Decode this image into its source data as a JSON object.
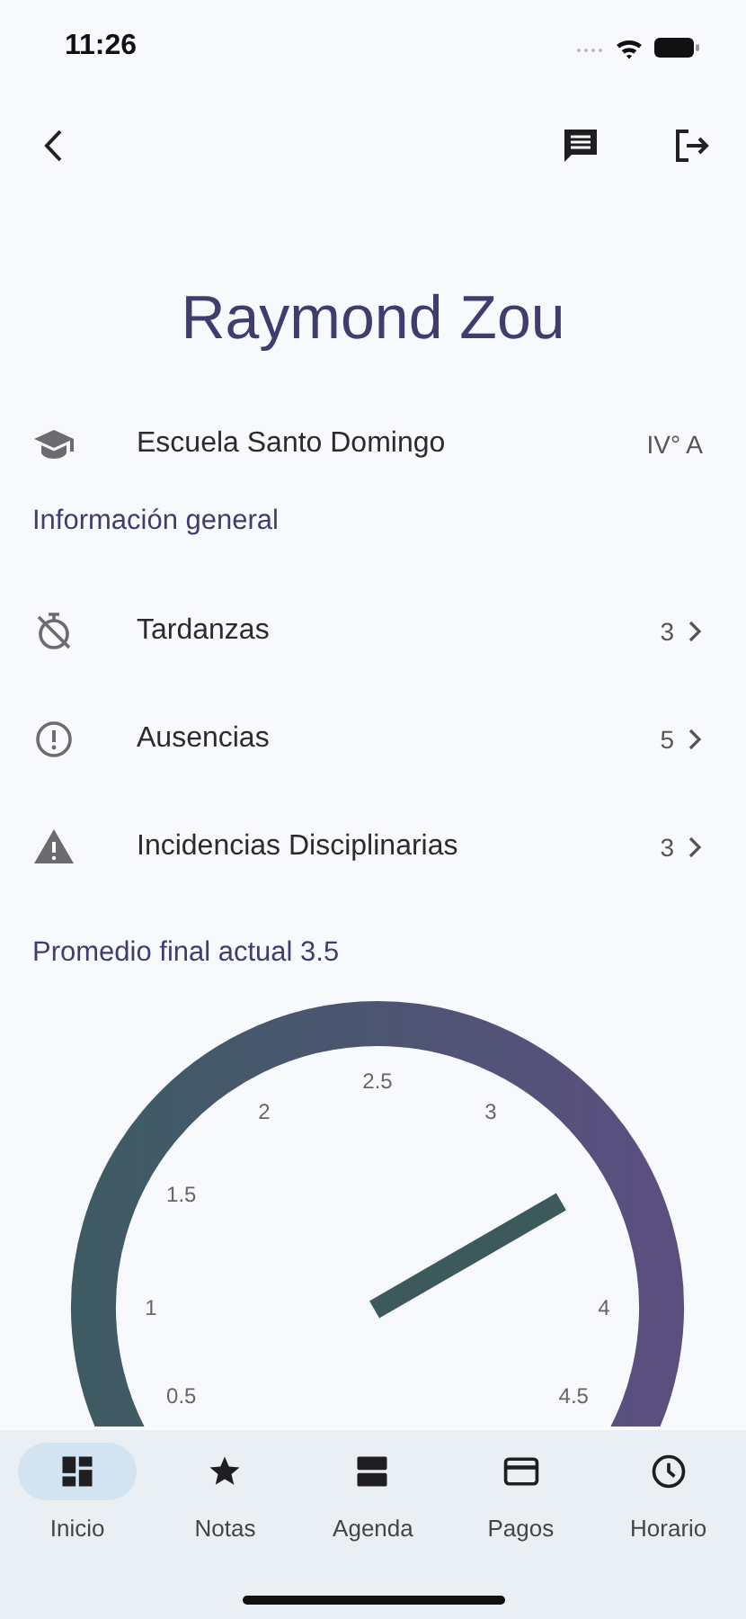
{
  "status_bar": {
    "time": "11:26"
  },
  "student": {
    "name": "Raymond Zou",
    "school": "Escuela Santo Domingo",
    "grade": "IV° A"
  },
  "section_title": "Información general",
  "items": [
    {
      "kind": "late",
      "label": "Tardanzas",
      "count": "3"
    },
    {
      "kind": "absence",
      "label": "Ausencias",
      "count": "5"
    },
    {
      "kind": "incident",
      "label": "Incidencias Disciplinarias",
      "count": "3"
    }
  ],
  "average_title": "Promedio final actual 3.5",
  "gauge": {
    "level": 0.7,
    "ticks": [
      "0.5",
      "1",
      "1.5",
      "2",
      "2.5",
      "3",
      "4",
      "4.5"
    ]
  },
  "nav": [
    {
      "kind": "dashboard",
      "label": "Inicio",
      "selected": true
    },
    {
      "kind": "star",
      "label": "Notas",
      "selected": false
    },
    {
      "kind": "agenda",
      "label": "Agenda",
      "selected": false
    },
    {
      "kind": "card",
      "label": "Pagos",
      "selected": false
    },
    {
      "kind": "clock",
      "label": "Horario",
      "selected": false
    }
  ]
}
